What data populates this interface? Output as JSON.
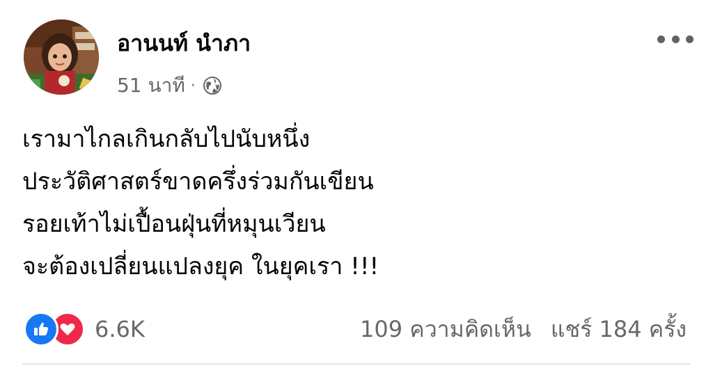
{
  "post": {
    "author": "อานนท์ นำภา",
    "timestamp": "51 นาที",
    "separator": "·",
    "privacy_icon": "globe-icon",
    "text_lines": [
      "เรามาไกลเกินกลับไปนับหนึ่ง",
      "ประวัติศาสตร์ขาดครึ่งร่วมกันเขียน",
      "รอยเท้าไม่เปื้อนฝุ่นที่หมุนเวียน",
      "จะต้องเปลี่ยนแปลงยุค ในยุคเรา !!!"
    ]
  },
  "footer": {
    "reaction_count": "6.6K",
    "comments": "109 ความคิดเห็น",
    "shares": "แชร์ 184 ครั้ง"
  },
  "colors": {
    "like": "#1877f2",
    "love": "#f0284a",
    "secondary_text": "#65676b",
    "divider": "#e4e6eb"
  }
}
